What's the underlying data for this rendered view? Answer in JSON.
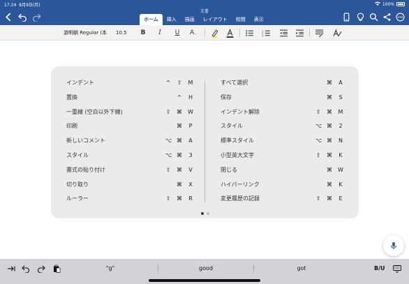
{
  "status_bar": {
    "time": "17:24",
    "date": "8月9日(月)",
    "battery": "100%"
  },
  "document": {
    "title": "文書"
  },
  "tabs": [
    {
      "label": "ホーム",
      "active": true
    },
    {
      "label": "挿入",
      "active": false
    },
    {
      "label": "描画",
      "active": false
    },
    {
      "label": "レイアウト",
      "active": false
    },
    {
      "label": "校閲",
      "active": false
    },
    {
      "label": "表示",
      "active": false
    }
  ],
  "ribbon": {
    "font_name": "游明朝 Regular (本",
    "font_size": "10.5",
    "bold": "B",
    "italic": "I",
    "underline": "U",
    "font_color_glyph": "A"
  },
  "shortcuts": {
    "left": [
      {
        "label": "インデント",
        "keys": [
          "^",
          "⇧",
          "M"
        ]
      },
      {
        "label": "置換",
        "keys": [
          "^",
          "H"
        ]
      },
      {
        "label": "一重線 (空白以外下線)",
        "keys": [
          "⇧",
          "⌘",
          "W"
        ]
      },
      {
        "label": "印刷",
        "keys": [
          "⌘",
          "P"
        ]
      },
      {
        "label": "新しいコメント",
        "keys": [
          "⌥",
          "⌘",
          "A"
        ]
      },
      {
        "label": "スタイル",
        "keys": [
          "⌥",
          "⌘",
          "3"
        ]
      },
      {
        "label": "書式の貼り付け",
        "keys": [
          "⇧",
          "⌘",
          "V"
        ]
      },
      {
        "label": "切り取り",
        "keys": [
          "⌘",
          "X"
        ]
      },
      {
        "label": "ルーラー",
        "keys": [
          "⇧",
          "⌘",
          "R"
        ]
      }
    ],
    "right": [
      {
        "label": "すべて選択",
        "keys": [
          "⌘",
          "A"
        ]
      },
      {
        "label": "保存",
        "keys": [
          "⌘",
          "S"
        ]
      },
      {
        "label": "インデント解除",
        "keys": [
          "⇧",
          "⌘",
          "M"
        ]
      },
      {
        "label": "スタイル",
        "keys": [
          "⌥",
          "⌘",
          "2"
        ]
      },
      {
        "label": "標準スタイル",
        "keys": [
          "⌥",
          "⌘",
          "N"
        ]
      },
      {
        "label": "小型英大文字",
        "keys": [
          "⇧",
          "⌘",
          "K"
        ]
      },
      {
        "label": "閉じる",
        "keys": [
          "⌘",
          "W"
        ]
      },
      {
        "label": "ハイパーリンク",
        "keys": [
          "⌘",
          "K"
        ]
      },
      {
        "label": "変更履歴の記録",
        "keys": [
          "⇧",
          "⌘",
          "E"
        ]
      }
    ]
  },
  "page_indicator": {
    "total": 2,
    "current": 1
  },
  "keyboard_bar": {
    "suggestions": [
      "\"g\"",
      "good",
      "got"
    ],
    "format_label": "B/U"
  },
  "colors": {
    "header_blue": "#2b579a",
    "panel_bg": "#ebebed",
    "keyboard_bg": "#d1d3d8"
  },
  "icons": {
    "header_left": [
      "back-icon",
      "undo-icon",
      "redo-icon"
    ],
    "header_right": [
      "tablet-view-icon",
      "lightbulb-icon",
      "search-icon",
      "share-icon",
      "more-icon"
    ],
    "keyboard_left": [
      "tab-icon",
      "undo-icon",
      "redo-icon",
      "paste-icon"
    ],
    "keyboard_right": [
      "keyboard-dismiss-icon"
    ]
  }
}
